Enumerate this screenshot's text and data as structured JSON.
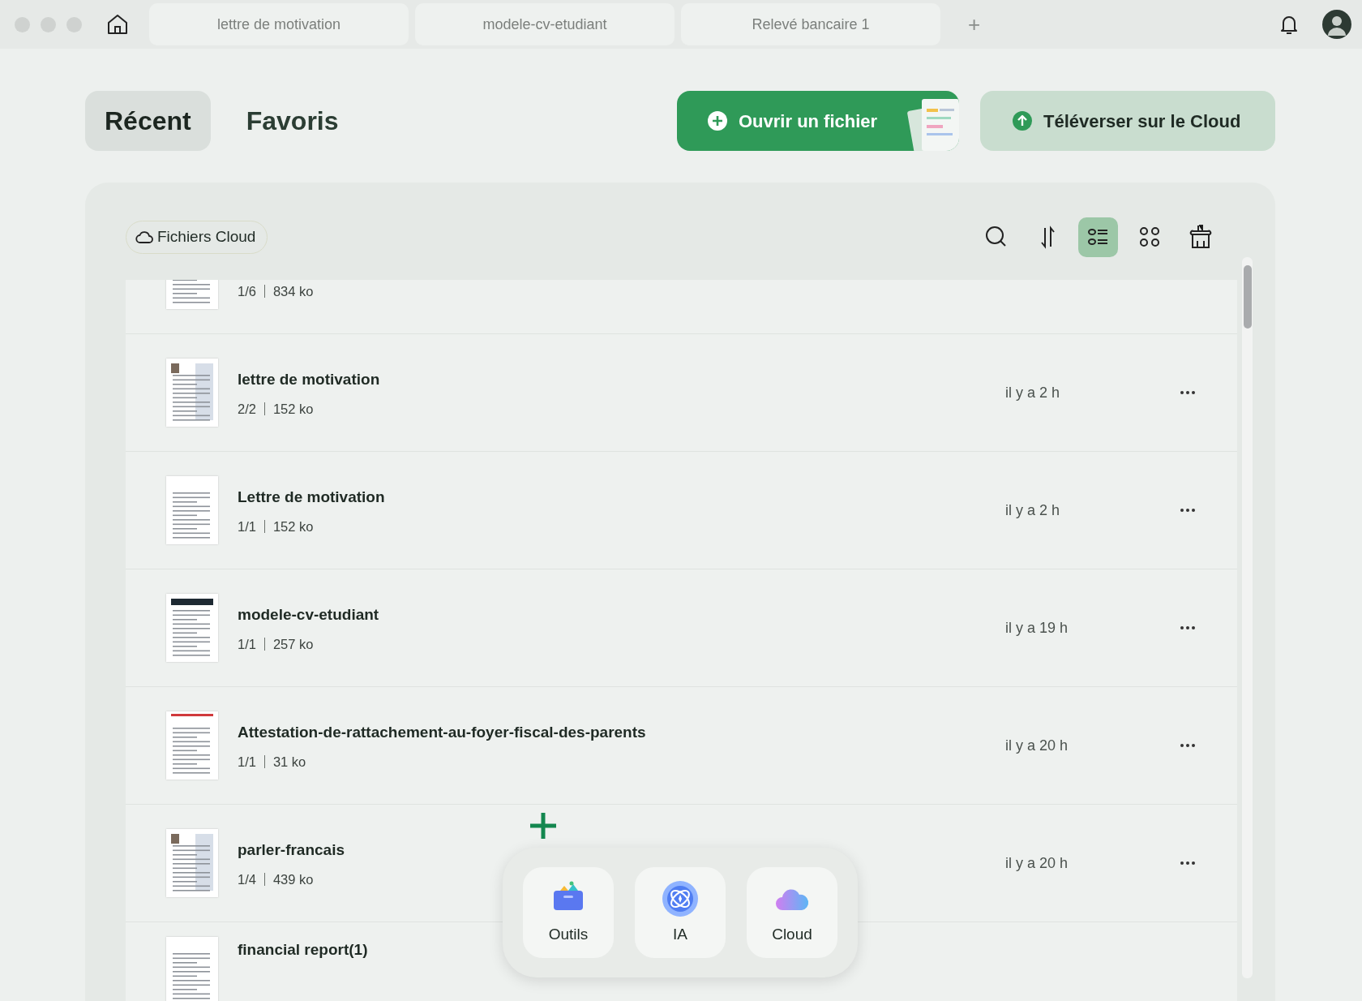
{
  "window_tabs": [
    {
      "label": "lettre de motivation"
    },
    {
      "label": "modele-cv-etudiant"
    },
    {
      "label": "Relevé bancaire 1"
    }
  ],
  "new_tab": {
    "label": "+"
  },
  "sections": [
    {
      "label": "Récent",
      "selected": true
    },
    {
      "label": "Favoris",
      "selected": false
    }
  ],
  "actions": [
    {
      "label": "Ouvrir un fichier",
      "kind": "primary"
    },
    {
      "label": "Téléverser sur le Cloud",
      "kind": "secondary"
    }
  ],
  "filter": {
    "label": "Fichiers Cloud"
  },
  "view_modes": [
    {
      "kind": "list",
      "selected": true
    },
    {
      "kind": "grid",
      "selected": false
    }
  ],
  "files": [
    {
      "pages": "1/6",
      "size": "834 ko"
    },
    {
      "name": "lettre de motivation",
      "pages": "2/2",
      "size": "152 ko",
      "date": "il y a 2 h"
    },
    {
      "name": "Lettre de motivation",
      "pages": "1/1",
      "size": "152 ko",
      "date": "il y a 2 h"
    },
    {
      "name": "modele-cv-etudiant",
      "pages": "1/1",
      "size": "257 ko",
      "date": "il y a 19 h"
    },
    {
      "name": "Attestation-de-rattachement-au-foyer-fiscal-des-parents",
      "pages": "1/1",
      "size": "31 ko",
      "date": "il y a 20 h"
    },
    {
      "name": "parler-francais",
      "pages": "1/4",
      "size": "439 ko",
      "date": "il y a 20 h"
    },
    {
      "name": "financial report(1)"
    }
  ],
  "dock": [
    {
      "label": "Outils",
      "kind": "tools"
    },
    {
      "label": "IA",
      "kind": "ai"
    },
    {
      "label": "Cloud",
      "kind": "cloud"
    }
  ]
}
